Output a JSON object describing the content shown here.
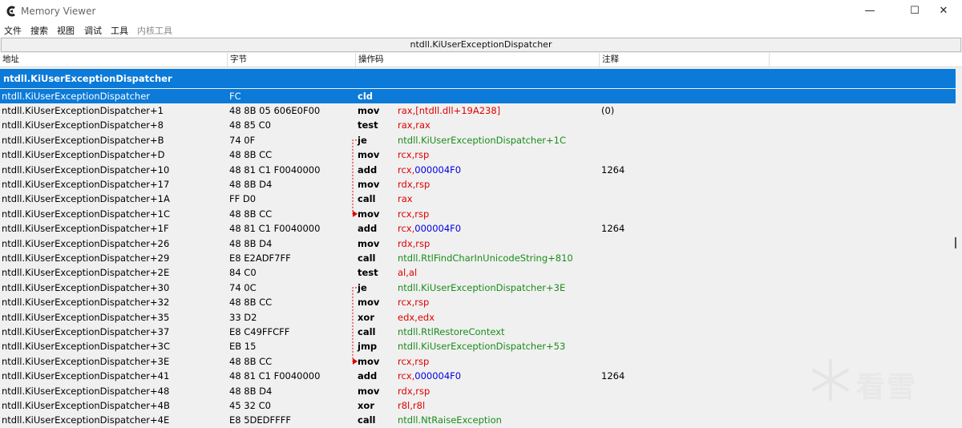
{
  "window": {
    "title": "Memory Viewer",
    "buttons": {
      "minimize": "—",
      "maximize": "☐",
      "close": "✕"
    }
  },
  "menu": [
    {
      "label": "文件",
      "enabled": true
    },
    {
      "label": "搜索",
      "enabled": true
    },
    {
      "label": "视图",
      "enabled": true
    },
    {
      "label": "调试",
      "enabled": true
    },
    {
      "label": "工具",
      "enabled": true
    },
    {
      "label": "内核工具",
      "enabled": false
    }
  ],
  "address_bar": "ntdll.KiUserExceptionDispatcher",
  "columns": {
    "address": "地址",
    "bytes": "字节",
    "opcode": "操作码",
    "comment": "注释"
  },
  "symbol_header": "ntdll.KiUserExceptionDispatcher",
  "rows": [
    {
      "addr": "ntdll.KiUserExceptionDispatcher",
      "bytes": "FC",
      "op": "cld",
      "args": [],
      "comment": "",
      "selected": true
    },
    {
      "addr": "ntdll.KiUserExceptionDispatcher+1",
      "bytes": "48 8B 05 606E0F00",
      "op": "mov",
      "args": [
        {
          "t": "rax,[ntdll.dll+19A238]",
          "c": "reg"
        }
      ],
      "comment": "(0)"
    },
    {
      "addr": "ntdll.KiUserExceptionDispatcher+8",
      "bytes": "48 85 C0",
      "op": "test",
      "args": [
        {
          "t": "rax,rax",
          "c": "reg"
        }
      ],
      "comment": ""
    },
    {
      "addr": "ntdll.KiUserExceptionDispatcher+B",
      "bytes": "74 0F",
      "op": "je",
      "args": [
        {
          "t": "ntdll.KiUserExceptionDispatcher+1C",
          "c": "lbl"
        }
      ],
      "comment": ""
    },
    {
      "addr": "ntdll.KiUserExceptionDispatcher+D",
      "bytes": "48 8B CC",
      "op": "mov",
      "args": [
        {
          "t": "rcx,rsp",
          "c": "reg"
        }
      ],
      "comment": ""
    },
    {
      "addr": "ntdll.KiUserExceptionDispatcher+10",
      "bytes": "48 81 C1 F0040000",
      "op": "add",
      "args": [
        {
          "t": "rcx,",
          "c": "reg"
        },
        {
          "t": "000004F0",
          "c": "num"
        }
      ],
      "comment": "1264"
    },
    {
      "addr": "ntdll.KiUserExceptionDispatcher+17",
      "bytes": "48 8B D4",
      "op": "mov",
      "args": [
        {
          "t": "rdx,rsp",
          "c": "reg"
        }
      ],
      "comment": ""
    },
    {
      "addr": "ntdll.KiUserExceptionDispatcher+1A",
      "bytes": "FF D0",
      "op": "call",
      "args": [
        {
          "t": "rax",
          "c": "reg"
        }
      ],
      "comment": ""
    },
    {
      "addr": "ntdll.KiUserExceptionDispatcher+1C",
      "bytes": "48 8B CC",
      "op": "mov",
      "args": [
        {
          "t": "rcx,rsp",
          "c": "reg"
        }
      ],
      "comment": ""
    },
    {
      "addr": "ntdll.KiUserExceptionDispatcher+1F",
      "bytes": "48 81 C1 F0040000",
      "op": "add",
      "args": [
        {
          "t": "rcx,",
          "c": "reg"
        },
        {
          "t": "000004F0",
          "c": "num"
        }
      ],
      "comment": "1264"
    },
    {
      "addr": "ntdll.KiUserExceptionDispatcher+26",
      "bytes": "48 8B D4",
      "op": "mov",
      "args": [
        {
          "t": "rdx,rsp",
          "c": "reg"
        }
      ],
      "comment": ""
    },
    {
      "addr": "ntdll.KiUserExceptionDispatcher+29",
      "bytes": "E8 E2ADF7FF",
      "op": "call",
      "args": [
        {
          "t": "ntdll.RtlFindCharInUnicodeString+810",
          "c": "lbl"
        }
      ],
      "comment": ""
    },
    {
      "addr": "ntdll.KiUserExceptionDispatcher+2E",
      "bytes": "84 C0",
      "op": "test",
      "args": [
        {
          "t": "al,al",
          "c": "reg"
        }
      ],
      "comment": ""
    },
    {
      "addr": "ntdll.KiUserExceptionDispatcher+30",
      "bytes": "74 0C",
      "op": "je",
      "args": [
        {
          "t": "ntdll.KiUserExceptionDispatcher+3E",
          "c": "lbl"
        }
      ],
      "comment": ""
    },
    {
      "addr": "ntdll.KiUserExceptionDispatcher+32",
      "bytes": "48 8B CC",
      "op": "mov",
      "args": [
        {
          "t": "rcx,rsp",
          "c": "reg"
        }
      ],
      "comment": ""
    },
    {
      "addr": "ntdll.KiUserExceptionDispatcher+35",
      "bytes": "33 D2",
      "op": "xor",
      "args": [
        {
          "t": "edx,edx",
          "c": "reg"
        }
      ],
      "comment": ""
    },
    {
      "addr": "ntdll.KiUserExceptionDispatcher+37",
      "bytes": "E8 C49FFCFF",
      "op": "call",
      "args": [
        {
          "t": "ntdll.RtlRestoreContext",
          "c": "lbl"
        }
      ],
      "comment": ""
    },
    {
      "addr": "ntdll.KiUserExceptionDispatcher+3C",
      "bytes": "EB 15",
      "op": "jmp",
      "args": [
        {
          "t": "ntdll.KiUserExceptionDispatcher+53",
          "c": "lbl"
        }
      ],
      "comment": ""
    },
    {
      "addr": "ntdll.KiUserExceptionDispatcher+3E",
      "bytes": "48 8B CC",
      "op": "mov",
      "args": [
        {
          "t": "rcx,rsp",
          "c": "reg"
        }
      ],
      "comment": ""
    },
    {
      "addr": "ntdll.KiUserExceptionDispatcher+41",
      "bytes": "48 81 C1 F0040000",
      "op": "add",
      "args": [
        {
          "t": "rcx,",
          "c": "reg"
        },
        {
          "t": "000004F0",
          "c": "num"
        }
      ],
      "comment": "1264"
    },
    {
      "addr": "ntdll.KiUserExceptionDispatcher+48",
      "bytes": "48 8B D4",
      "op": "mov",
      "args": [
        {
          "t": "rdx,rsp",
          "c": "reg"
        }
      ],
      "comment": ""
    },
    {
      "addr": "ntdll.KiUserExceptionDispatcher+4B",
      "bytes": "45 32 C0",
      "op": "xor",
      "args": [
        {
          "t": "r8l,r8l",
          "c": "reg"
        }
      ],
      "comment": ""
    },
    {
      "addr": "ntdll.KiUserExceptionDispatcher+4E",
      "bytes": "E8 5DEDFFFF",
      "op": "call",
      "args": [
        {
          "t": "ntdll.NtRaiseException",
          "c": "lbl"
        }
      ],
      "comment": ""
    }
  ],
  "jumps": [
    {
      "from": 3,
      "to": 8
    },
    {
      "from": 13,
      "to": 18
    }
  ],
  "watermark": {
    "text": "看雪",
    "icon": "snowflake-logo-icon"
  },
  "colors": {
    "selection": "#0b7ad8",
    "register": "#e00000",
    "label": "#1b8c1b",
    "immediate": "#0000e0",
    "jump_arrow": "#e00000"
  }
}
